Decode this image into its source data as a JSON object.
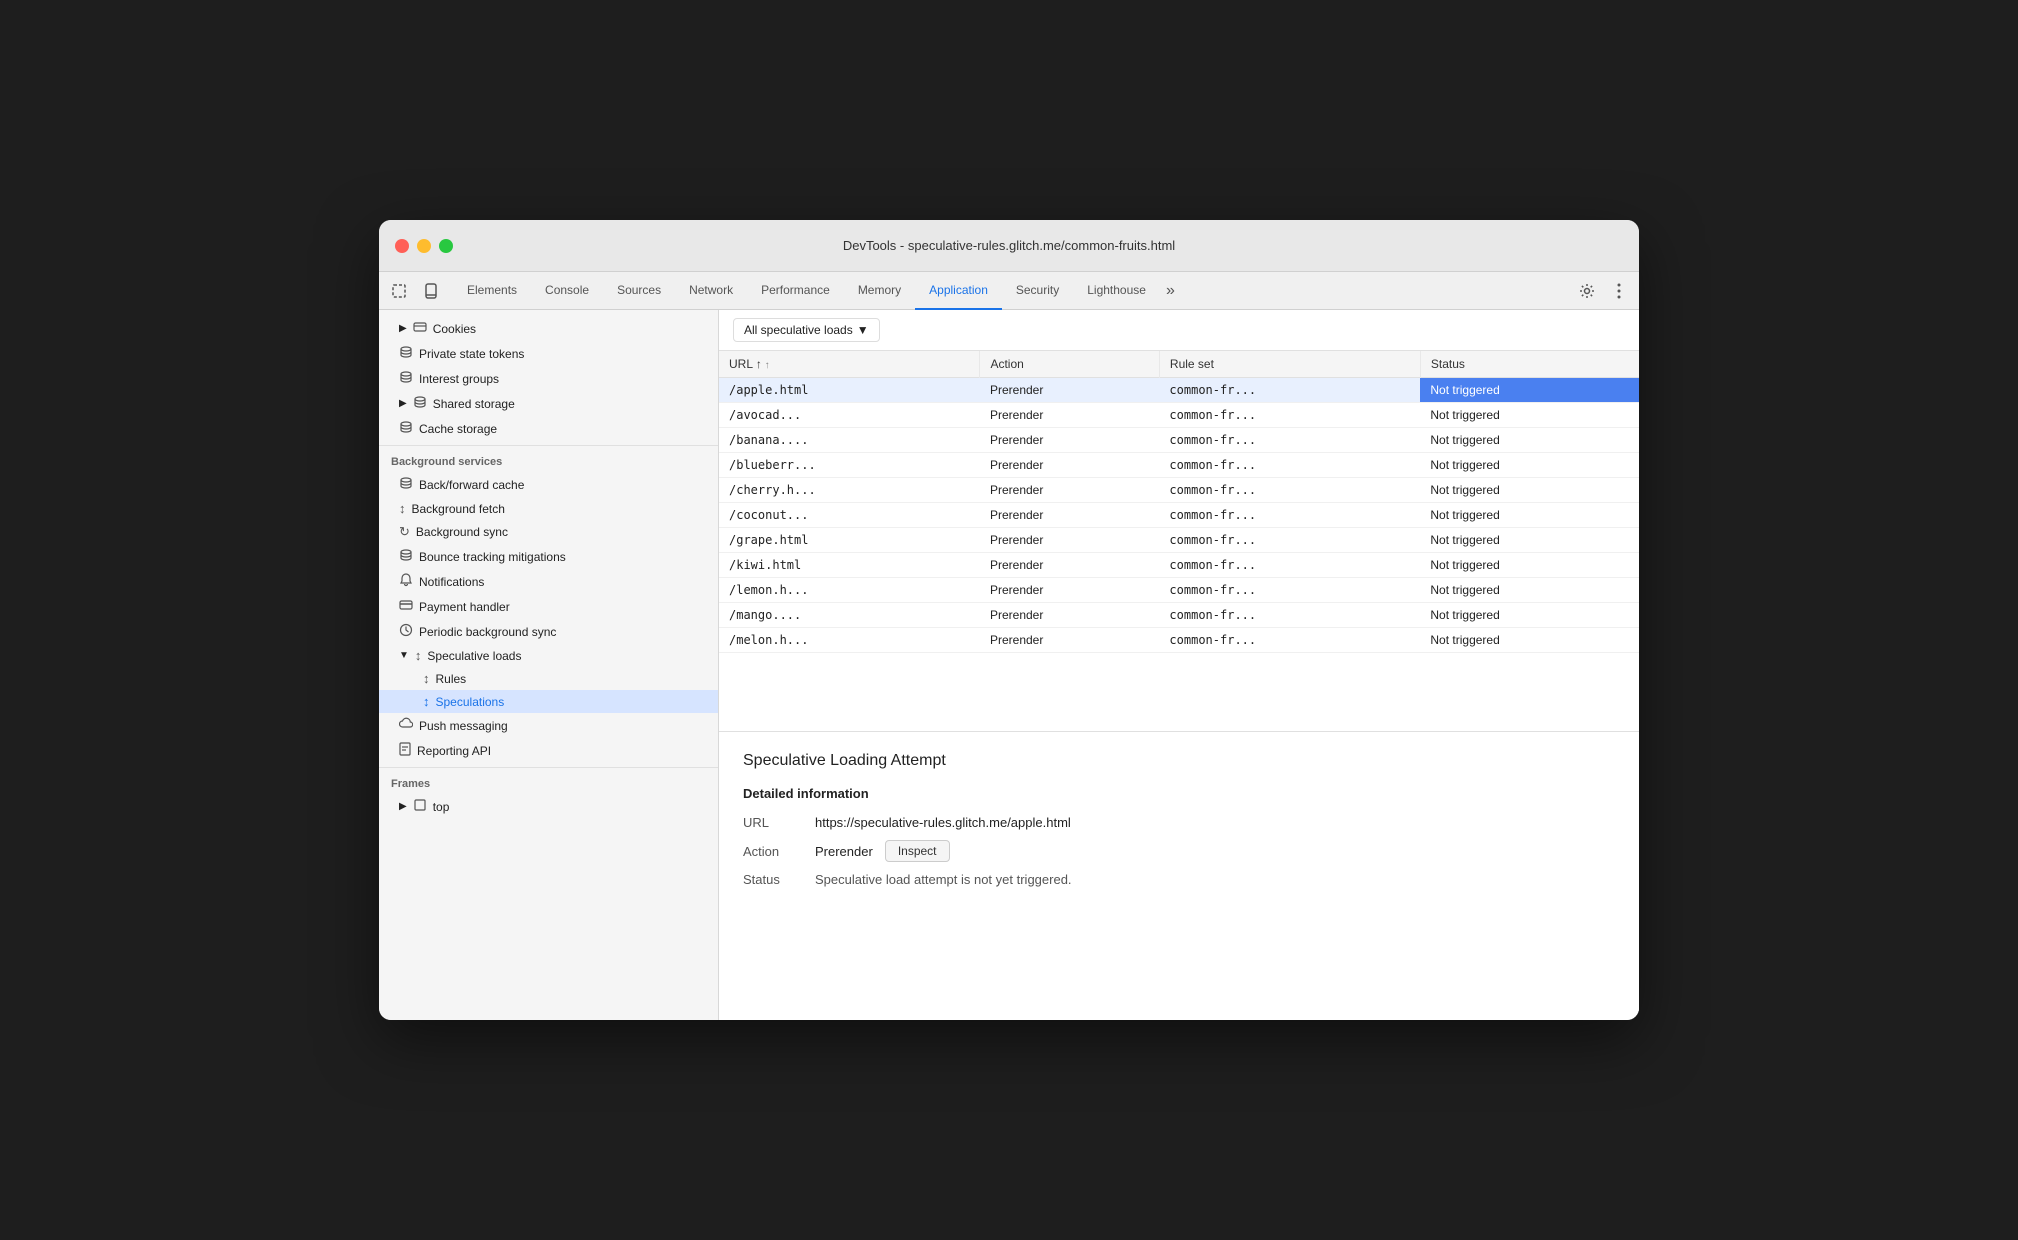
{
  "window": {
    "title": "DevTools - speculative-rules.glitch.me/common-fruits.html"
  },
  "devtools": {
    "tabs": [
      {
        "label": "Elements",
        "active": false
      },
      {
        "label": "Console",
        "active": false
      },
      {
        "label": "Sources",
        "active": false
      },
      {
        "label": "Network",
        "active": false
      },
      {
        "label": "Performance",
        "active": false
      },
      {
        "label": "Memory",
        "active": false
      },
      {
        "label": "Application",
        "active": true
      },
      {
        "label": "Security",
        "active": false
      },
      {
        "label": "Lighthouse",
        "active": false
      }
    ]
  },
  "sidebar": {
    "sections": [
      {
        "name": "storage",
        "items": [
          {
            "label": "Cookies",
            "icon": "▶ 🗄",
            "indent": 0,
            "has_arrow": true
          },
          {
            "label": "Private state tokens",
            "icon": "🗄",
            "indent": 0
          },
          {
            "label": "Interest groups",
            "icon": "🗄",
            "indent": 0
          },
          {
            "label": "Shared storage",
            "icon": "▶ 🗄",
            "indent": 0,
            "has_arrow": true
          },
          {
            "label": "Cache storage",
            "icon": "🗄",
            "indent": 0
          }
        ]
      },
      {
        "name": "background-services",
        "header": "Background services",
        "items": [
          {
            "label": "Back/forward cache",
            "icon": "🗄",
            "indent": 0
          },
          {
            "label": "Background fetch",
            "icon": "↕",
            "indent": 0
          },
          {
            "label": "Background sync",
            "icon": "↻",
            "indent": 0
          },
          {
            "label": "Bounce tracking mitigations",
            "icon": "🗄",
            "indent": 0
          },
          {
            "label": "Notifications",
            "icon": "🔔",
            "indent": 0
          },
          {
            "label": "Payment handler",
            "icon": "💳",
            "indent": 0
          },
          {
            "label": "Periodic background sync",
            "icon": "🕐",
            "indent": 0
          },
          {
            "label": "Speculative loads",
            "icon": "↕",
            "indent": 0,
            "expanded": true,
            "has_arrow": true
          },
          {
            "label": "Rules",
            "icon": "↕",
            "indent": 1
          },
          {
            "label": "Speculations",
            "icon": "↕",
            "indent": 1,
            "active": true
          },
          {
            "label": "Push messaging",
            "icon": "☁",
            "indent": 0
          },
          {
            "label": "Reporting API",
            "icon": "📄",
            "indent": 0
          }
        ]
      },
      {
        "name": "frames",
        "header": "Frames",
        "items": [
          {
            "label": "top",
            "icon": "▶ 🖥",
            "indent": 0,
            "has_arrow": true
          }
        ]
      }
    ]
  },
  "filter": {
    "label": "All speculative loads",
    "dropdown_arrow": "▼"
  },
  "table": {
    "columns": [
      {
        "key": "url",
        "label": "URL",
        "sortable": true
      },
      {
        "key": "action",
        "label": "Action"
      },
      {
        "key": "rule_set",
        "label": "Rule set"
      },
      {
        "key": "status",
        "label": "Status"
      }
    ],
    "rows": [
      {
        "url": "/apple.html",
        "action": "Prerender",
        "rule_set": "common-fr...",
        "status": "Not triggered",
        "selected": true
      },
      {
        "url": "/avocad...",
        "action": "Prerender",
        "rule_set": "common-fr...",
        "status": "Not triggered"
      },
      {
        "url": "/banana....",
        "action": "Prerender",
        "rule_set": "common-fr...",
        "status": "Not triggered"
      },
      {
        "url": "/blueberr...",
        "action": "Prerender",
        "rule_set": "common-fr...",
        "status": "Not triggered"
      },
      {
        "url": "/cherry.h...",
        "action": "Prerender",
        "rule_set": "common-fr...",
        "status": "Not triggered"
      },
      {
        "url": "/coconut...",
        "action": "Prerender",
        "rule_set": "common-fr...",
        "status": "Not triggered"
      },
      {
        "url": "/grape.html",
        "action": "Prerender",
        "rule_set": "common-fr...",
        "status": "Not triggered"
      },
      {
        "url": "/kiwi.html",
        "action": "Prerender",
        "rule_set": "common-fr...",
        "status": "Not triggered"
      },
      {
        "url": "/lemon.h...",
        "action": "Prerender",
        "rule_set": "common-fr...",
        "status": "Not triggered"
      },
      {
        "url": "/mango....",
        "action": "Prerender",
        "rule_set": "common-fr...",
        "status": "Not triggered"
      },
      {
        "url": "/melon.h...",
        "action": "Prerender",
        "rule_set": "common-fr...",
        "status": "Not triggered"
      }
    ]
  },
  "detail": {
    "title": "Speculative Loading Attempt",
    "section_title": "Detailed information",
    "url_label": "URL",
    "url_value": "https://speculative-rules.glitch.me/apple.html",
    "action_label": "Action",
    "action_value": "Prerender",
    "inspect_label": "Inspect",
    "status_label": "Status",
    "status_value": "Speculative load attempt is not yet triggered."
  },
  "colors": {
    "active_tab": "#1a73e8",
    "selected_row_bg": "#e8f0fe",
    "selected_status_bg": "#4a80f0",
    "selected_status_text": "#ffffff"
  }
}
